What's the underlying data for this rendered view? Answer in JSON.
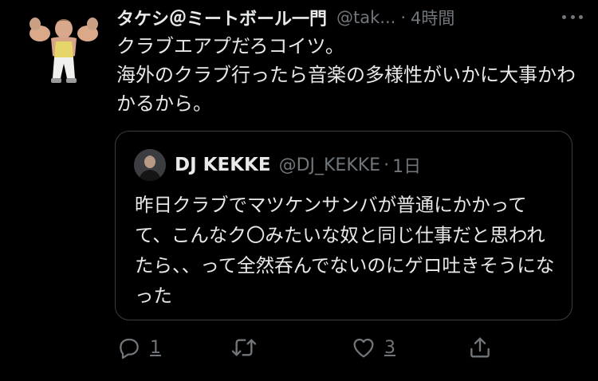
{
  "tweet": {
    "author_name": "タケシ＠ミートボール一門",
    "handle": "@tak...",
    "separator": "·",
    "time": "4時間",
    "text": "クラブエアプだろコイツ。\n海外のクラブ行ったら音楽の多様性がいかに大事かわかるから。"
  },
  "quoted": {
    "author_name": "DJ KEKKE",
    "handle": "@DJ_KEKKE",
    "separator": "·",
    "time": "1日",
    "text": "昨日クラブでマツケンサンバが普通にかかってて、こんなク〇みたいな奴と同じ仕事だと思われたら、、って全然呑んでないのにゲロ吐きそうになった"
  },
  "actions": {
    "reply_count": "1",
    "retweet_count": "",
    "like_count": "3"
  },
  "icons": {
    "more": "more-horizontal-icon",
    "reply": "reply-icon",
    "retweet": "retweet-icon",
    "like": "heart-icon",
    "share": "share-icon"
  },
  "colors": {
    "background": "#000000",
    "text": "#e7e9ea",
    "secondary": "#71767b",
    "border": "#3a3d41"
  }
}
